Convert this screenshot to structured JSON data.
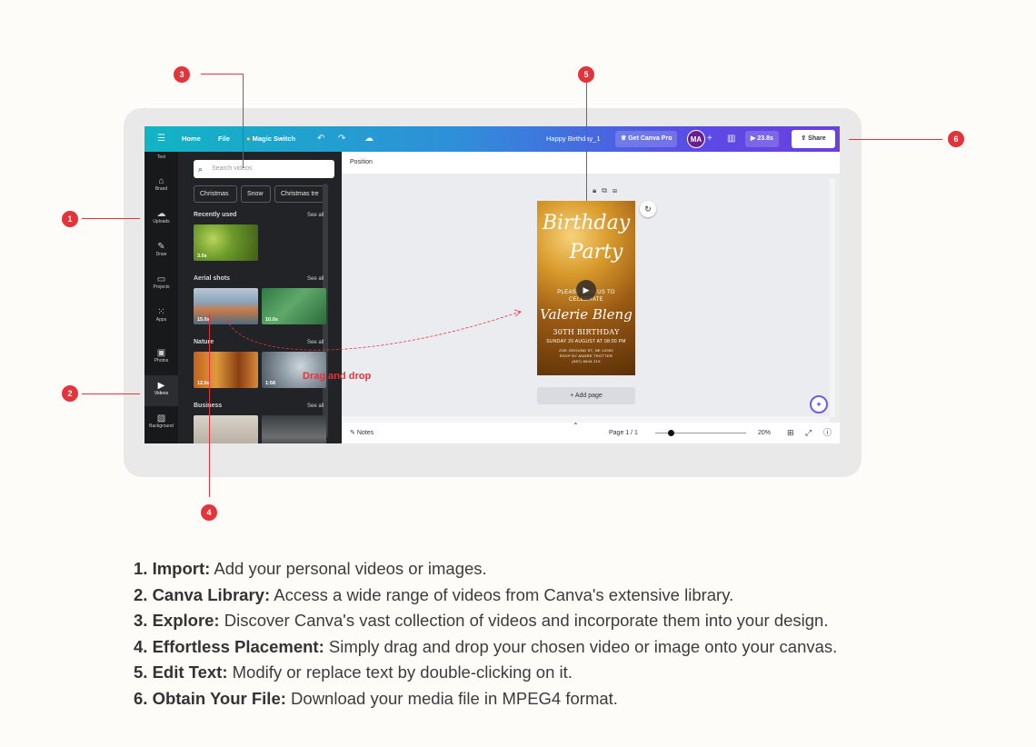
{
  "topbar": {
    "home": "Home",
    "file": "File",
    "magic_switch": "Magic Switch",
    "doc_title": "Happy Birthday_1",
    "get_pro": "Get Canva Pro",
    "avatar_initials": "MA",
    "play_time": "23.8s",
    "share": "Share"
  },
  "rail": {
    "items": [
      {
        "label": "Text"
      },
      {
        "label": "Brand"
      },
      {
        "label": "Uploads"
      },
      {
        "label": "Draw"
      },
      {
        "label": "Projects"
      },
      {
        "label": "Apps"
      },
      {
        "label": "Photos"
      },
      {
        "label": "Videos"
      },
      {
        "label": "Background"
      }
    ]
  },
  "panel": {
    "search_placeholder": "Search videos",
    "chips": [
      "Christmas",
      "Snow",
      "Christmas tre"
    ],
    "sections": [
      {
        "title": "Recently used",
        "see_all": "See all",
        "durations": [
          "3.0s"
        ]
      },
      {
        "title": "Aerial shots",
        "see_all": "See all",
        "durations": [
          "15.0s",
          "10.0s"
        ]
      },
      {
        "title": "Nature",
        "see_all": "See all",
        "durations": [
          "12.0s",
          "1:58"
        ]
      },
      {
        "title": "Business",
        "see_all": "See all",
        "durations": []
      }
    ]
  },
  "editor": {
    "position": "Position",
    "design": {
      "line1": "Birthday",
      "line2": "Party",
      "please": "PLEASE JOIN US TO",
      "celebrate": "CELEBRATE",
      "name": "Valerie Bleng",
      "age": "30TH BIRTHDAY",
      "date": "SUNDAY 20 AUGUST AT 08:00 PM",
      "address1": "ZOE GROUND ST, NE 12000",
      "address2": "RSVP BY ANDRE TROTTER",
      "phone": "(987) 6543 210"
    },
    "add_page": "+ Add page",
    "notes": "Notes",
    "page_indicator": "Page 1 / 1",
    "zoom": "20%"
  },
  "annotation": {
    "drag_drop": "Drag and drop",
    "badges": [
      "1",
      "2",
      "3",
      "4",
      "5",
      "6"
    ]
  },
  "instructions": [
    {
      "title": "1. Import:",
      "text": " Add your personal videos or images."
    },
    {
      "title": "2. Canva Library:",
      "text": " Access a wide range of videos from Canva's extensive library."
    },
    {
      "title": "3. Explore:",
      "text": " Discover Canva's vast collection of videos and incorporate them into your design."
    },
    {
      "title": "4. Effortless Placement:",
      "text": " Simply drag and drop your chosen video or image onto your canvas."
    },
    {
      "title": "5. Edit Text:",
      "text": " Modify or replace text by double-clicking on it."
    },
    {
      "title": "6. Obtain Your File:",
      "text": " Download your media file in MPEG4 format."
    }
  ],
  "colors": {
    "accent_red": "#e3343c",
    "topbar_start": "#11b5c4",
    "topbar_end": "#6b3fe0",
    "panel_bg": "#222326"
  }
}
